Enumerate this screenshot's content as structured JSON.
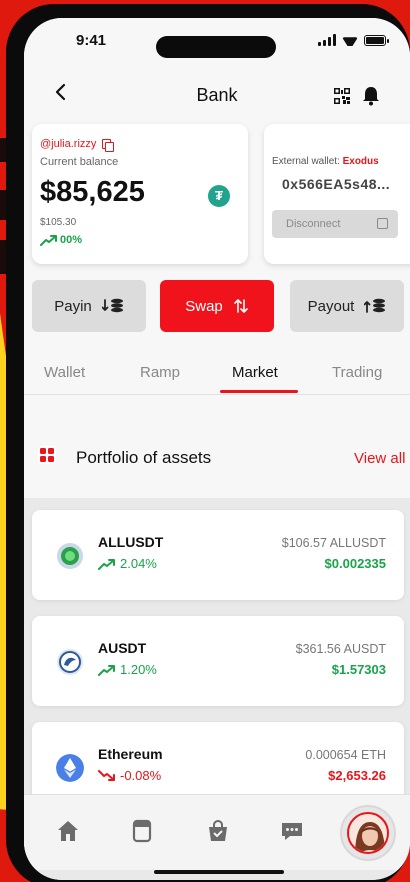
{
  "status_bar": {
    "time": "9:41"
  },
  "header": {
    "title": "Bank"
  },
  "balance_card": {
    "handle": "@julia.rizzy",
    "label": "Current balance",
    "amount": "$85,625",
    "sub_amount": "$105.30",
    "change": "00%"
  },
  "external_wallet": {
    "label": "External wallet: ",
    "provider": "Exodus",
    "address": "0x566EA5s48...",
    "disconnect_label": "Disconnect"
  },
  "actions": {
    "payin": "Payin",
    "swap": "Swap",
    "payout": "Payout"
  },
  "tabs": [
    {
      "label": "Wallet"
    },
    {
      "label": "Ramp"
    },
    {
      "label": "Market"
    },
    {
      "label": "Trading"
    }
  ],
  "active_tab": "Market",
  "portfolio": {
    "title": "Portfolio of assets",
    "view_all": "View all"
  },
  "assets": [
    {
      "name": "ALLUSDT",
      "change": "2.04%",
      "direction": "up",
      "holding": "$106.57 ALLUSDT",
      "value": "$0.002335"
    },
    {
      "name": "AUSDT",
      "change": "1.20%",
      "direction": "up",
      "holding": "$361.56 AUSDT",
      "value": "$1.57303"
    },
    {
      "name": "Ethereum",
      "change": "-0.08%",
      "direction": "down",
      "holding": "0.000654 ETH",
      "value": "$2,653.26"
    }
  ],
  "colors": {
    "brand_red": "#e8151b",
    "positive_green": "#1aa34a",
    "tether_teal": "#21a38d",
    "ethereum_blue": "#4a7fe8"
  },
  "bottom_nav": {
    "items": [
      "home-icon",
      "card-icon",
      "shopping-bag-icon",
      "chat-icon",
      "avatar"
    ]
  }
}
